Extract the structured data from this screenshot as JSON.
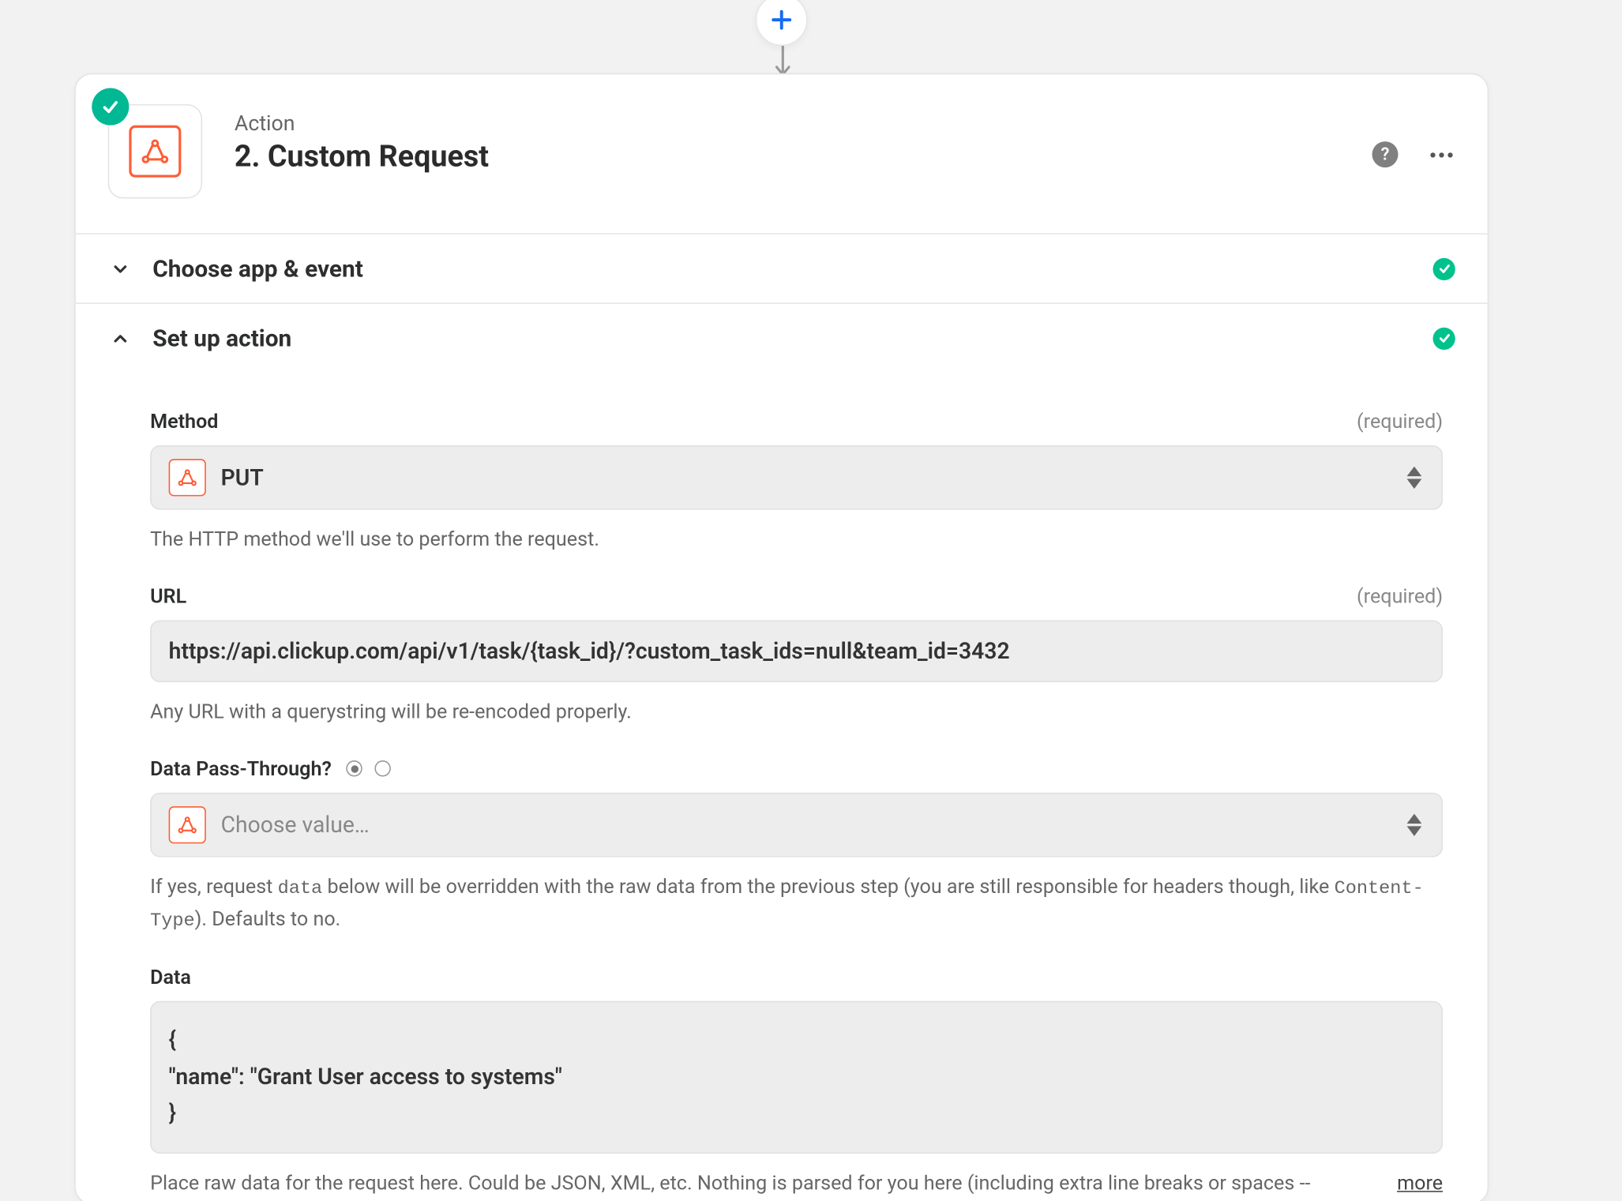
{
  "header": {
    "subtitle": "Action",
    "title": "2. Custom Request"
  },
  "sections": {
    "choose_app": {
      "title": "Choose app & event"
    },
    "setup": {
      "title": "Set up action"
    }
  },
  "fields": {
    "method": {
      "label": "Method",
      "required": "(required)",
      "value": "PUT",
      "helper": "The HTTP method we'll use to perform the request."
    },
    "url": {
      "label": "URL",
      "required": "(required)",
      "value": "https://api.clickup.com/api/v1/task/{task_id}/?custom_task_ids=null&team_id=3432",
      "helper": "Any URL with a querystring will be re-encoded properly."
    },
    "passthrough": {
      "label": "Data Pass-Through?",
      "placeholder": "Choose value…",
      "helper_pre": "If yes, request ",
      "helper_code1": "data",
      "helper_mid": " below will be overridden with the raw data from the previous step (you are still responsible for headers though, like ",
      "helper_code2": "Content-Type",
      "helper_post": "). Defaults to no."
    },
    "data": {
      "label": "Data",
      "line1": "{",
      "line2": "\"name\": \"Grant User access to systems\"",
      "line3": "}",
      "helper": "Place raw data for the request here. Could be JSON, XML, etc. Nothing is parsed for you here (including extra line breaks or spaces --",
      "more": "more"
    }
  }
}
